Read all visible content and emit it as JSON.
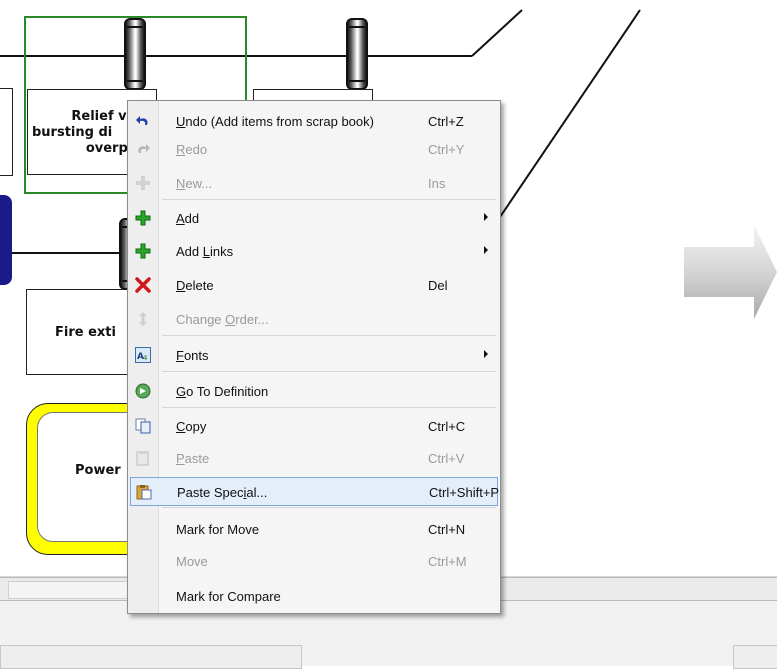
{
  "canvas": {
    "blocks": [
      {
        "lines": [
          "Relief v",
          "bursting di",
          "overpr"
        ]
      },
      {
        "lines": [
          "Fire exti"
        ]
      },
      {
        "lines": [
          "Power"
        ]
      }
    ]
  },
  "context_menu": {
    "items": [
      {
        "icon": "undo-icon",
        "label_u": "U",
        "label_rest": "ndo (Add items from scrap book)",
        "shortcut": "Ctrl+Z",
        "enabled": true
      },
      {
        "icon": "redo-icon",
        "label_u": "R",
        "label_rest": "edo",
        "shortcut": "Ctrl+Y",
        "enabled": false
      },
      {
        "icon": "new-icon",
        "label_u": "N",
        "label_rest": "ew...",
        "shortcut": "Ins",
        "enabled": false
      },
      {
        "icon": "add-icon",
        "label_u": "A",
        "label_rest": "dd",
        "shortcut": "",
        "enabled": true,
        "submenu": true
      },
      {
        "icon": "add-links-icon",
        "label_pre": "Add ",
        "label_u": "L",
        "label_rest": "inks",
        "shortcut": "",
        "enabled": true,
        "submenu": true
      },
      {
        "icon": "delete-icon",
        "label_u": "D",
        "label_rest": "elete",
        "shortcut": "Del",
        "enabled": true
      },
      {
        "icon": "change-order-icon",
        "label_pre": "Change ",
        "label_u": "O",
        "label_rest": "rder...",
        "shortcut": "",
        "enabled": false
      },
      {
        "icon": "fonts-icon",
        "label_u": "F",
        "label_rest": "onts",
        "shortcut": "",
        "enabled": true,
        "submenu": true
      },
      {
        "icon": "go-to-definition-icon",
        "label_u": "G",
        "label_rest": "o To Definition",
        "shortcut": "",
        "enabled": true
      },
      {
        "icon": "copy-icon",
        "label_u": "C",
        "label_rest": "opy",
        "shortcut": "Ctrl+C",
        "enabled": true
      },
      {
        "icon": "paste-icon",
        "label_u": "P",
        "label_rest": "aste",
        "shortcut": "Ctrl+V",
        "enabled": false
      },
      {
        "icon": "paste-special-icon",
        "label_pre": "Paste Spec",
        "label_u": "i",
        "label_rest": "al...",
        "shortcut": "Ctrl+Shift+P",
        "enabled": true,
        "highlighted": true
      },
      {
        "icon": "",
        "label_pre": "Mark for Move",
        "shortcut": "Ctrl+N",
        "enabled": true
      },
      {
        "icon": "",
        "label_pre": "Move",
        "shortcut": "Ctrl+M",
        "enabled": false
      },
      {
        "icon": "",
        "label_pre": "Mark for Compare",
        "shortcut": "",
        "enabled": true
      }
    ]
  }
}
